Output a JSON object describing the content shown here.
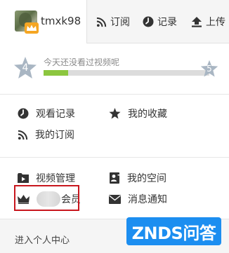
{
  "header": {
    "username": "tmxk98",
    "nav": [
      {
        "label": "订阅",
        "icon": "rss-icon"
      },
      {
        "label": "记录",
        "icon": "clock-icon"
      },
      {
        "label": "上传",
        "icon": "upload-icon"
      }
    ]
  },
  "progress": {
    "current_level": "4",
    "next_level": "5",
    "message": "今天还没看过视频呢",
    "fill_fraction": 0.15,
    "fill_color": "#8cc63f",
    "star_color": "#a9b6c3"
  },
  "menu": {
    "history": "观看记录",
    "favorites": "我的收藏",
    "subscriptions": "我的订阅",
    "video_manage": "视频管理",
    "my_space": "我的空间",
    "vip_member": "会员",
    "notifications": "消息通知"
  },
  "footer": {
    "personal_center": "进入个人中心"
  },
  "watermark": {
    "text": "ZNDS问答"
  },
  "colors": {
    "highlight": "#c8161d",
    "watermark_bg": "#1c8ef0"
  }
}
